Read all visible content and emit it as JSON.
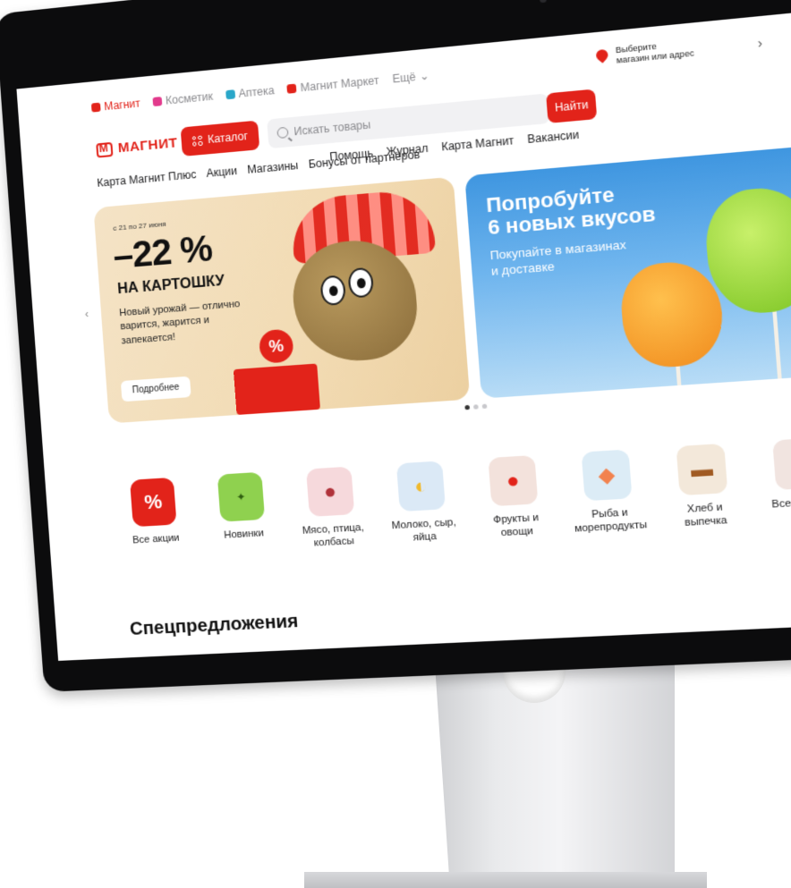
{
  "services": [
    {
      "label": "Магнит",
      "color": "#e2231a",
      "active": true
    },
    {
      "label": "Косметик",
      "color": "#e23a8c"
    },
    {
      "label": "Аптека",
      "color": "#2aa7c9"
    },
    {
      "label": "Магнит Маркет",
      "color": "#e2231a"
    },
    {
      "label": "Ещё"
    }
  ],
  "location": {
    "line1": "Выберите",
    "line2": "магазин или адрес"
  },
  "header": {
    "logo_text": "МАГНИТ",
    "catalog_label": "Каталог",
    "search_placeholder": "Искать товары",
    "find_label": "Найти"
  },
  "nav_top": [
    "Помощь",
    "Журнал",
    "Карта Магнит",
    "Вакансии"
  ],
  "nav_main": [
    "Карта Магнит Плюс",
    "Акции",
    "Магазины",
    "Бонусы от партнёров"
  ],
  "promo_left": {
    "date": "с 21 по 27 июня",
    "discount": "–22 %",
    "product": "НА КАРТОШКУ",
    "description": "Новый урожай — отлично варится, жарится и запекается!",
    "button": "Подробнее"
  },
  "promo_right": {
    "title_line1": "Попробуйте",
    "title_line2": "6 новых вкусов",
    "subtitle_line1": "Покупайте в магазинах",
    "subtitle_line2": "и доставке"
  },
  "carousel": {
    "active_index": 1,
    "count": 3
  },
  "categories": [
    {
      "label": "Все акции",
      "icon": "percent-icon",
      "color": "#e2231a"
    },
    {
      "label": "Новинки",
      "icon": "new-tag-icon",
      "color": "#8fd14f"
    },
    {
      "label": "Мясо, птица, колбасы",
      "icon": "meat-icon",
      "color": "#f6d9dc"
    },
    {
      "label": "Молоко, сыр, яйца",
      "icon": "milk-icon",
      "color": "#dbe9f6"
    },
    {
      "label": "Фрукты и овощи",
      "icon": "fruit-icon",
      "color": "#f3e2dc"
    },
    {
      "label": "Рыба и морепродукты",
      "icon": "fish-icon",
      "color": "#dcecf6"
    },
    {
      "label": "Хлеб и выпечка",
      "icon": "bread-icon",
      "color": "#f3e8da"
    },
    {
      "label": "Все товары",
      "icon": "all-goods-icon",
      "color": "#f1e4e0"
    }
  ],
  "specials_title": "Спецпредложения"
}
